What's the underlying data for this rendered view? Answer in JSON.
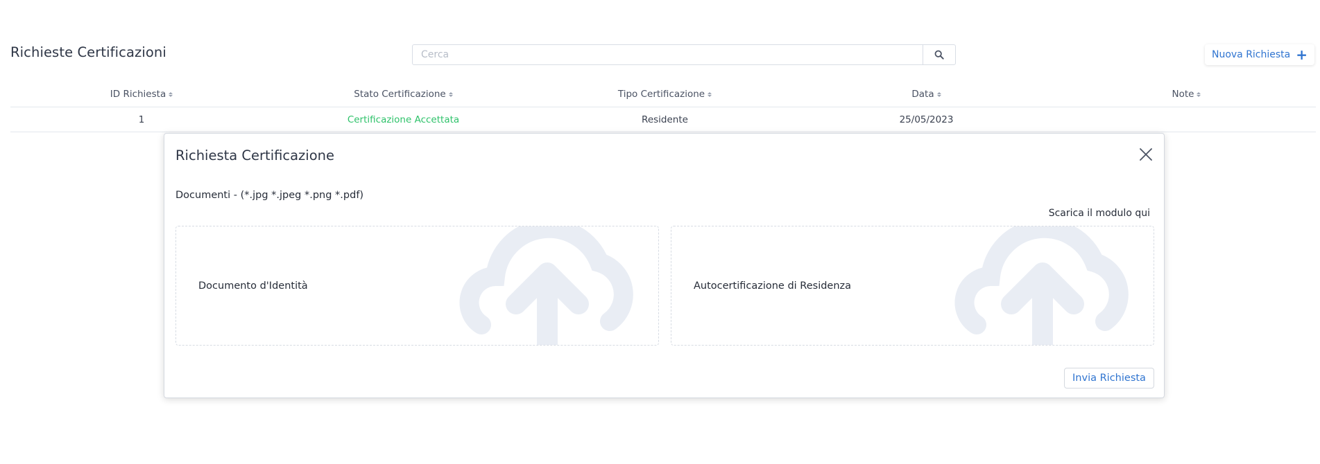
{
  "header": {
    "title": "Richieste Certificazioni",
    "search_placeholder": "Cerca",
    "new_request_label": "Nuova Richiesta"
  },
  "table": {
    "columns": [
      "ID Richiesta",
      "Stato Certificazione",
      "Tipo Certificazione",
      "Data",
      "Note"
    ],
    "rows": [
      {
        "id": "1",
        "status": "Certificazione Accettata",
        "type": "Residente",
        "date": "25/05/2023",
        "note": ""
      }
    ]
  },
  "modal": {
    "title": "Richiesta Certificazione",
    "documents_label": "Documenti - (*.jpg *.jpeg *.png *.pdf)",
    "download_label": "Scarica il modulo qui",
    "dropzones": [
      {
        "label": "Documento d'Identità"
      },
      {
        "label": "Autocertificazione di Residenza"
      }
    ],
    "submit_label": "Invia Richiesta"
  },
  "colors": {
    "accent": "#2f74d0",
    "status_success": "#2ec26a",
    "upload_icon": "#e9edf4"
  },
  "icons": {
    "search": "search-icon",
    "add": "plus-icon",
    "close": "close-icon",
    "upload": "cloud-upload-icon",
    "sort": "sort-icon"
  }
}
